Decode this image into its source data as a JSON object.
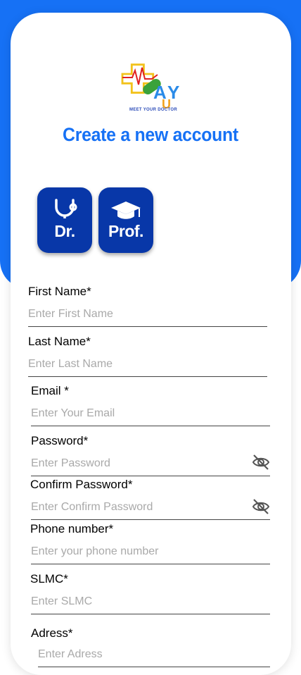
{
  "app": {
    "logo_tagline": "MEET YOUR DOCTOR",
    "title": "Create a new account"
  },
  "roles": [
    {
      "label": "Dr.",
      "icon": "stethoscope-icon"
    },
    {
      "label": "Prof.",
      "icon": "graduation-cap-icon"
    }
  ],
  "form": {
    "first_name": {
      "label": "First Name*",
      "placeholder": "Enter First Name"
    },
    "last_name": {
      "label": "Last Name*",
      "placeholder": "Enter Last Name"
    },
    "email": {
      "label": "Email *",
      "placeholder": "Enter Your Email"
    },
    "password": {
      "label": "Password*",
      "placeholder": "Enter Password"
    },
    "confirm_password": {
      "label": "Confirm Password*",
      "placeholder": "Enter Confirm Password"
    },
    "phone": {
      "label": "Phone number*",
      "placeholder": "Enter your phone number"
    },
    "slmc": {
      "label": "SLMC*",
      "placeholder": "Enter SLMC"
    },
    "address": {
      "label": "Adress*",
      "placeholder": "Enter Adress"
    }
  },
  "colors": {
    "accent": "#1671f5",
    "role_button": "#0837a8",
    "placeholder": "#a9a9a9"
  }
}
